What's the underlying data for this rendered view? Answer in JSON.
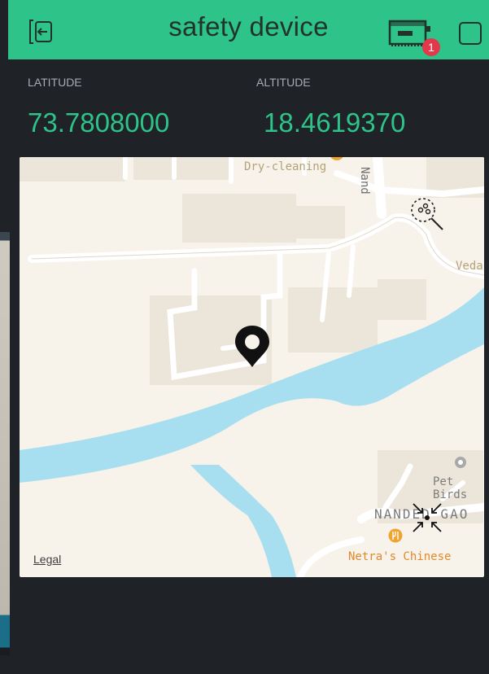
{
  "header": {
    "title": "safety device",
    "notification_count": "1",
    "icons": [
      "back-icon",
      "device-icon",
      "square-icon"
    ]
  },
  "latitude": {
    "label": "LATITUDE",
    "value": "73.7808000"
  },
  "altitude": {
    "label": "ALTITUDE",
    "value": "18.4619370"
  },
  "map": {
    "places": {
      "dry_cleaning": "Dry-cleaning",
      "nand": "Nand",
      "veda": "Veda",
      "pet_birds": "Pet Birds",
      "nanded_gao": "NANDED GAO",
      "netras_chinese": "Netra's Chinese"
    },
    "legal": "Legal",
    "icons": [
      "location-pin-icon",
      "search-places-icon",
      "collapse-icon"
    ]
  },
  "colors": {
    "accent": "#2ec489",
    "background": "#1f2227",
    "map_land": "#f7f2ea",
    "map_water": "#a8dff0",
    "badge": "#e3384b"
  }
}
